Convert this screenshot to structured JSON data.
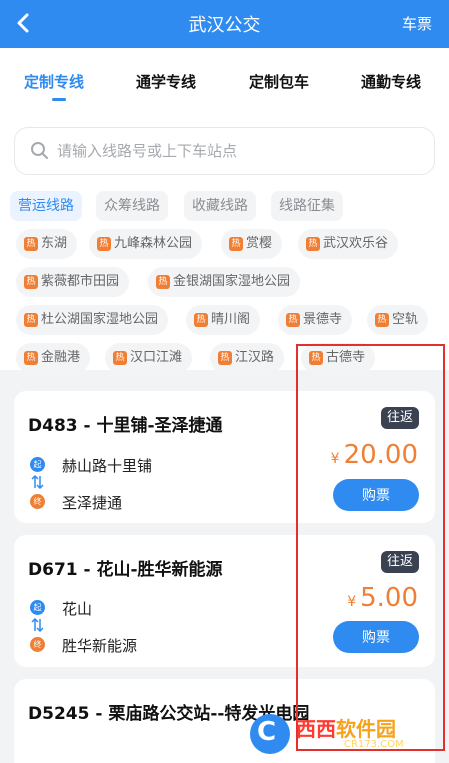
{
  "header": {
    "title": "武汉公交",
    "right_link": "车票",
    "bg_color": "#2f8bf0"
  },
  "tabs": [
    {
      "label": "定制专线",
      "active": true
    },
    {
      "label": "通学专线",
      "active": false
    },
    {
      "label": "定制包车",
      "active": false
    },
    {
      "label": "通勤专线",
      "active": false
    }
  ],
  "search": {
    "placeholder": "请输入线路号或上下车站点",
    "value": ""
  },
  "categories": [
    {
      "label": "营运线路",
      "active": true
    },
    {
      "label": "众筹线路",
      "active": false
    },
    {
      "label": "收藏线路",
      "active": false
    },
    {
      "label": "线路征集",
      "active": false
    }
  ],
  "hot_badge": "热",
  "hot_tags": [
    "东湖",
    "九峰森林公园",
    "赏樱",
    "武汉欢乐谷",
    "紫薇都市田园",
    "金银湖国家湿地公园",
    "杜公湖国家湿地公园",
    "晴川阁",
    "景德寺",
    "空轨",
    "金融港",
    "汉口江滩",
    "江汉路",
    "古德寺"
  ],
  "stop_labels": {
    "start": "起",
    "end": "终"
  },
  "routes": [
    {
      "name": "D483 - 十里铺-圣泽捷通",
      "badge": "往返",
      "start": "赫山路十里铺",
      "end": "圣泽捷通",
      "currency": "¥",
      "price": "20.00",
      "buy_label": "购票"
    },
    {
      "name": "D671 - 花山-胜华新能源",
      "badge": "往返",
      "start": "花山",
      "end": "胜华新能源",
      "currency": "¥",
      "price": "5.00",
      "buy_label": "购票"
    },
    {
      "name": "D5245 - 栗庙路公交站--特发光电园"
    }
  ],
  "watermark": {
    "part1": "西西",
    "part2": "软件园",
    "url": "CR173.COM"
  },
  "colors": {
    "accent": "#2f8bf0",
    "price": "#f07f36",
    "hot": "#f07f36",
    "badge_bg": "#3a4150",
    "highlight": "#e3302f"
  }
}
